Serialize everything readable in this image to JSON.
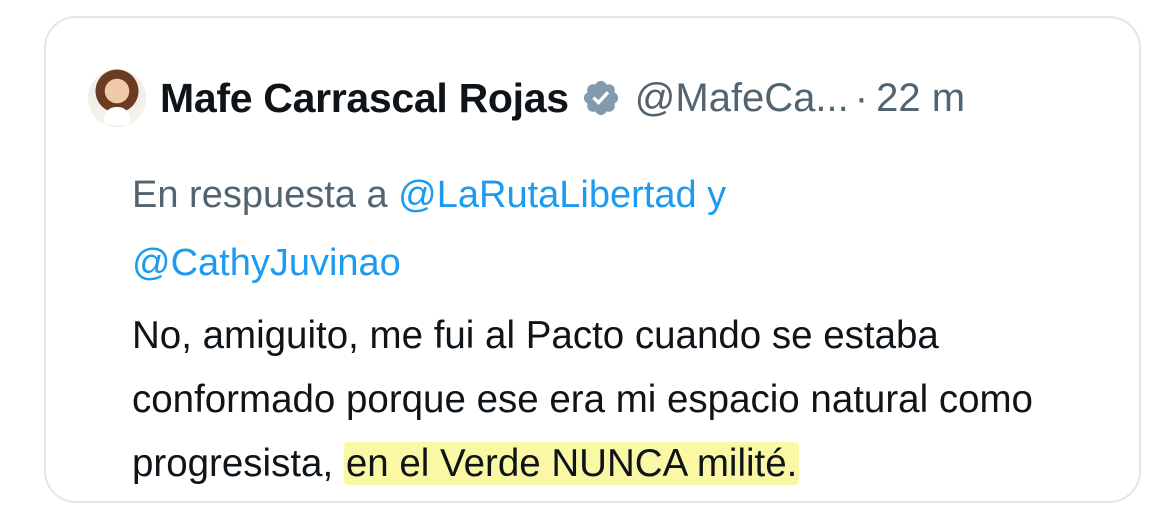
{
  "tweet": {
    "author_name": "Mafe Carrascal Rojas",
    "handle": "@MafeCa...",
    "separator": "·",
    "time": "22 m",
    "avatar": "avatar-photo",
    "verified_icon": "verified-badge-icon",
    "reply_prefix": "En respuesta a",
    "reply_mention_1": "@LaRutaLibertad",
    "reply_joiner": "y",
    "reply_mention_2": "@CathyJuvinao",
    "body_text": "No, amiguito, me fui al Pacto cuando se estaba conformado porque ese era mi espacio natural como progresista, ",
    "body_highlight": "en el Verde NUNCA milité.",
    "highlight_color": "#fbf8a5",
    "mention_color": "#1d9bf0"
  }
}
